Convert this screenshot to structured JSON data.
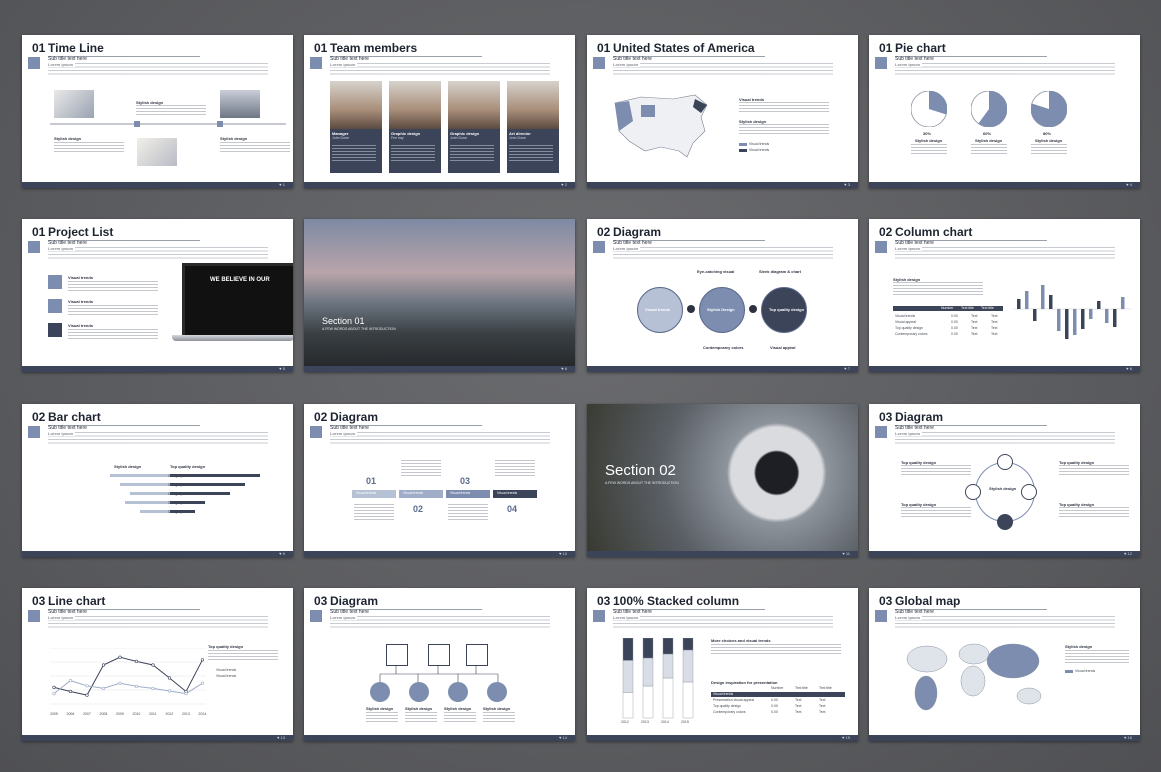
{
  "common": {
    "subtitle": "Sub title text here",
    "lorem": "Lorem ipsum",
    "stylish": "Stylish design",
    "visual_trends": "Visual trends",
    "top_quality": "Top quality design",
    "page_icon": "heart-icon"
  },
  "slides": [
    {
      "num": "01",
      "title": "Time Line"
    },
    {
      "num": "01",
      "title": "Team members",
      "people": [
        {
          "role": "Manager",
          "name": "John Done"
        },
        {
          "role": "Graphic design",
          "name": "Fen nay"
        },
        {
          "role": "Graphic design",
          "name": "John Done"
        },
        {
          "role": "Art director",
          "name": "John Done"
        }
      ]
    },
    {
      "num": "01",
      "title": "United States of America"
    },
    {
      "num": "01",
      "title": "Pie chart",
      "pies": [
        "30%",
        "60%",
        "80%"
      ]
    },
    {
      "num": "01",
      "title": "Project List",
      "laptop": "WE BELIEVE IN OUR"
    },
    {
      "title": "Section 01",
      "tagline": "A FEW WORDS ABOUT THE INTRODUCTION"
    },
    {
      "num": "02",
      "title": "Diagram",
      "labels": [
        "Eye-catching visual",
        "Sleek diagram & chart",
        "Contemporary colors",
        "Visual appeal"
      ],
      "circles": [
        "Visual trends",
        "Stylish Design",
        "Top quality design"
      ]
    },
    {
      "num": "02",
      "title": "Column chart",
      "table_head": [
        "Number",
        "Text title",
        "Text title"
      ],
      "rows": [
        [
          "Visual trends",
          "0.00",
          "Text",
          "Text"
        ],
        [
          "Visual appeal",
          "0.00",
          "Text",
          "Text"
        ],
        [
          "Top quality design",
          "0.00",
          "Text",
          "Text"
        ],
        [
          "Contemporary colors",
          "0.00",
          "Text",
          "Text"
        ]
      ]
    },
    {
      "num": "02",
      "title": "Bar chart",
      "categories": [
        "Category 01",
        "Category 02",
        "Category 03",
        "Category 04",
        "Category 05"
      ]
    },
    {
      "num": "02",
      "title": "Diagram",
      "steps": [
        "01",
        "02",
        "03",
        "04"
      ]
    },
    {
      "title": "Section 02",
      "tagline": "A FEW WORDS ABOUT THE INTRODUCTION"
    },
    {
      "num": "03",
      "title": "Diagram"
    },
    {
      "num": "03",
      "title": "Line chart",
      "years": [
        "2005",
        "2006",
        "2007",
        "2008",
        "2009",
        "2010",
        "2011",
        "2012",
        "2013",
        "2014"
      ]
    },
    {
      "num": "03",
      "title": "Diagram"
    },
    {
      "num": "03",
      "title": "100% Stacked column",
      "heading": "More choices and visual trends",
      "heading2": "Design inspiration for presentation",
      "table_head": [
        "Number",
        "Text title",
        "Text title"
      ],
      "rows": [
        [
          "Visual trends",
          "",
          "",
          ""
        ],
        [
          "Presentation visual appeal",
          "0.00",
          "Text",
          "Text"
        ],
        [
          "Top quality design",
          "0.00",
          "Text",
          "Text"
        ],
        [
          "Contemporary colors",
          "0.00",
          "Text",
          "Text"
        ]
      ],
      "years": [
        "2012",
        "2013",
        "2014",
        "2015"
      ]
    },
    {
      "num": "03",
      "title": "Global map"
    }
  ],
  "chart_data": [
    {
      "type": "pie",
      "title": "Pie chart",
      "categories": [
        "Stylish design",
        "Stylish design",
        "Stylish design"
      ],
      "values": [
        30,
        60,
        80
      ]
    },
    {
      "type": "bar",
      "title": "Column chart",
      "categories": [
        "Visual trends",
        "Visual appeal",
        "Top quality design",
        "Contemporary colors"
      ]
    },
    {
      "type": "bar",
      "title": "Bar chart",
      "categories": [
        "Category 01",
        "Category 02",
        "Category 03",
        "Category 04",
        "Category 05"
      ],
      "series": [
        {
          "name": "Stylish design",
          "values": [
            -60,
            -50,
            -40,
            -45,
            -30
          ]
        },
        {
          "name": "Top quality design",
          "values": [
            90,
            75,
            60,
            35,
            25
          ]
        }
      ],
      "xlim": [
        -100,
        100
      ]
    },
    {
      "type": "line",
      "title": "Line chart",
      "x": [
        "2005",
        "2006",
        "2007",
        "2008",
        "2009",
        "2010",
        "2011",
        "2012",
        "2013",
        "2014"
      ],
      "series": [
        {
          "name": "Visual trends",
          "values": [
            32,
            24,
            17,
            75,
            90,
            82,
            75,
            50,
            24,
            85
          ]
        },
        {
          "name": "Visual trends",
          "values": [
            20,
            45,
            35,
            30,
            40,
            34,
            30,
            25,
            20,
            40
          ]
        }
      ],
      "ylim": [
        0,
        100
      ]
    },
    {
      "type": "bar",
      "title": "100% Stacked column",
      "categories": [
        "2012",
        "2013",
        "2014",
        "2015"
      ],
      "series": [
        {
          "name": "Visual trends",
          "values": [
            32,
            40,
            50,
            45
          ]
        },
        {
          "name": "Visual trends",
          "values": [
            40,
            35,
            30,
            40
          ]
        },
        {
          "name": "Visual trends",
          "values": [
            28,
            25,
            20,
            15
          ]
        }
      ],
      "ylim": [
        0,
        100
      ]
    }
  ],
  "colors": {
    "accent": "#7c8db0",
    "dark": "#3b4458",
    "line": "#9aa0ab"
  }
}
